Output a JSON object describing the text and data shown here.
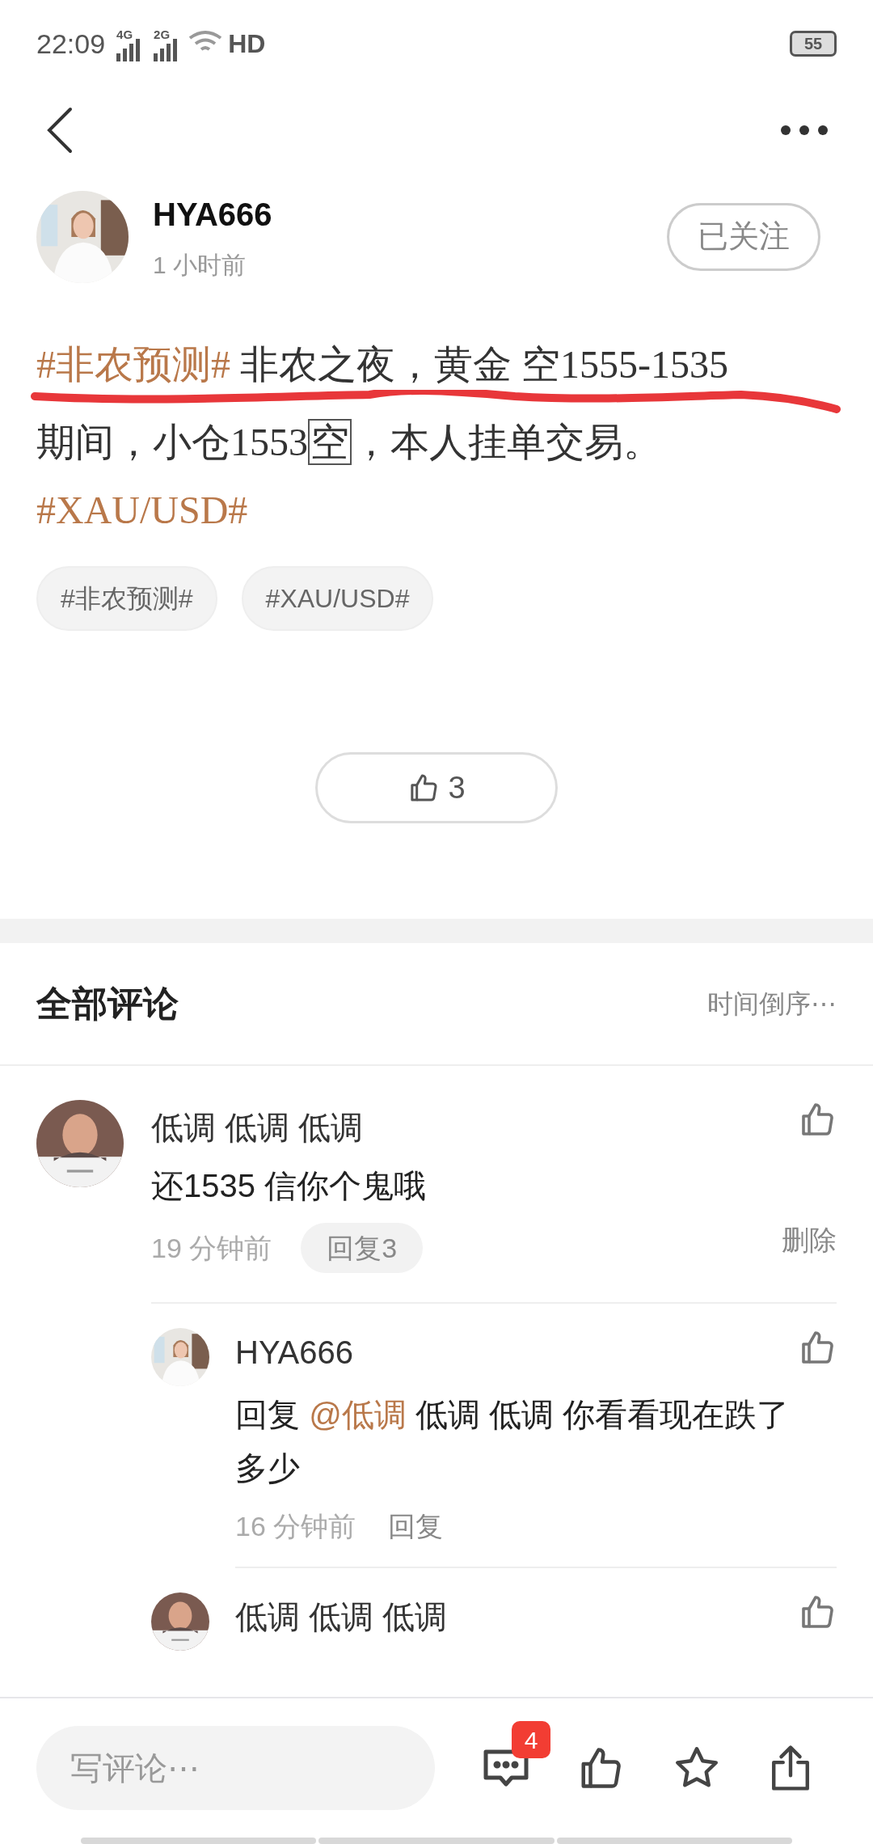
{
  "status_bar": {
    "time": "22:09",
    "network_1": "4G",
    "network_2": "2G",
    "hd": "HD",
    "battery": "55"
  },
  "post": {
    "author": "HYA666",
    "time": "1 小时前",
    "follow_button": "已关注",
    "lines": [
      [
        {
          "kind": "topic",
          "text": "#非农预测#"
        },
        {
          "kind": "plain",
          "text": " 非农之夜，黄金 空1555-1535"
        }
      ],
      [
        {
          "kind": "plain",
          "text": "期间，小仓1553"
        },
        {
          "kind": "boxed",
          "text": "空"
        },
        {
          "kind": "plain",
          "text": "，本人挂单交易。"
        }
      ],
      [
        {
          "kind": "topic",
          "text": "#XAU/USD#"
        }
      ]
    ],
    "tags": [
      "#非农预测#",
      "#XAU/USD#"
    ],
    "likes": "3"
  },
  "comments_header": {
    "title": "全部评论",
    "sort": "时间倒序⋯"
  },
  "comments": [
    {
      "author": "低调 低调 低调",
      "text": [
        {
          "kind": "plain",
          "text": "还1535 信你个鬼哦"
        }
      ],
      "time": "19 分钟前",
      "reply_button": "回复3",
      "delete": "删除",
      "replies": [
        {
          "author": "HYA666",
          "text": [
            {
              "kind": "plain",
              "text": "回复 "
            },
            {
              "kind": "mention",
              "text": "@低调"
            },
            {
              "kind": "plain",
              "text": " 低调 低调 你看看现在跌了多少"
            }
          ],
          "time": "16 分钟前",
          "reply_button": "回复"
        },
        {
          "author": "低调 低调 低调"
        }
      ]
    }
  ],
  "bottom_bar": {
    "placeholder": "写评论⋯",
    "comment_count": "4"
  }
}
